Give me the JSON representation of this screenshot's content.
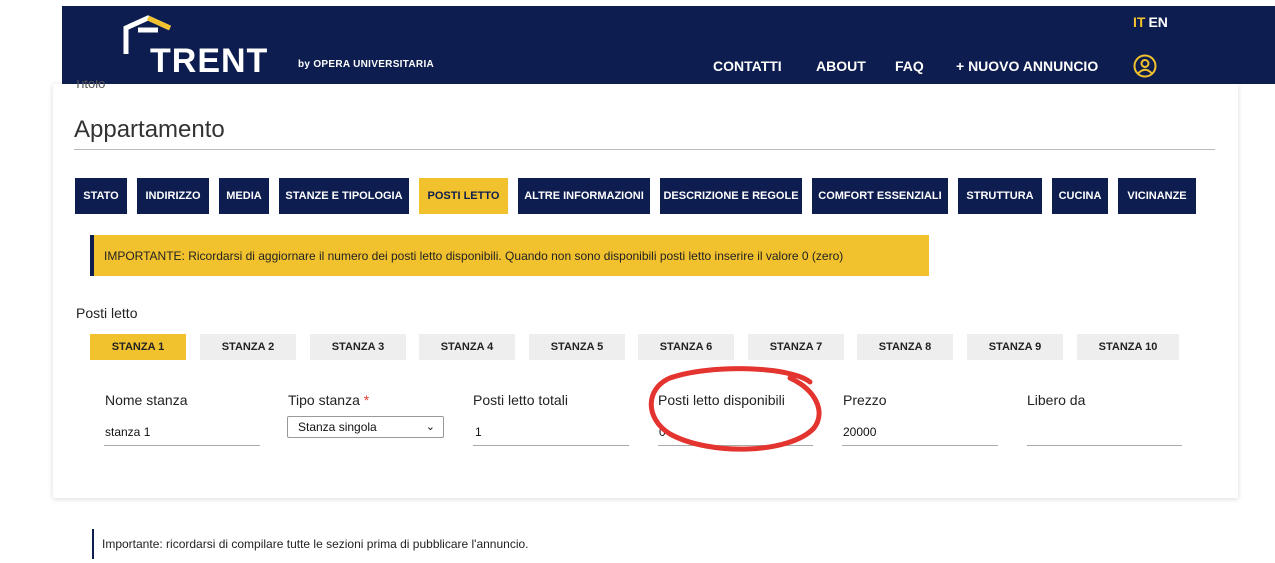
{
  "header": {
    "logo_text": "TRENT",
    "logo_by": "by OPERA UNIVERSITARIA",
    "nav": [
      "CONTATTI",
      "ABOUT",
      "FAQ",
      "+ NUOVO ANNUNCIO"
    ],
    "lang_it": "IT",
    "lang_en": "EN",
    "colors": {
      "navy": "#0d1d4f",
      "accent": "#f2c12e"
    }
  },
  "form": {
    "titolo_label": "Titolo",
    "title": "Appartamento",
    "tabs": [
      "STATO",
      "INDIRIZZO",
      "MEDIA",
      "STANZE E TIPOLOGIA",
      "POSTI LETTO",
      "ALTRE INFORMAZIONI",
      "DESCRIZIONE E REGOLE",
      "COMFORT ESSENZIALI",
      "STRUTTURA",
      "CUCINA",
      "VICINANZE"
    ],
    "active_tab": "POSTI LETTO",
    "alert": "IMPORTANTE: Ricordarsi di aggiornare il numero dei posti letto disponibili. Quando non sono disponibili posti letto inserire il valore 0 (zero)",
    "section_label": "Posti letto",
    "room_tabs": [
      "STANZA 1",
      "STANZA 2",
      "STANZA 3",
      "STANZA 4",
      "STANZA 5",
      "STANZA 6",
      "STANZA 7",
      "STANZA 8",
      "STANZA 9",
      "STANZA 10"
    ],
    "active_room": "STANZA 1",
    "fields": {
      "nome_label": "Nome stanza",
      "nome_value": "stanza 1",
      "tipo_label": "Tipo stanza",
      "tipo_required": "*",
      "tipo_value": "Stanza singola",
      "totali_label": "Posti letto totali",
      "totali_value": "1",
      "disponibili_label": "Posti letto disponibili",
      "disponibili_value": "0",
      "prezzo_label": "Prezzo",
      "prezzo_value": "20000",
      "libero_label": "Libero da",
      "libero_value": ""
    }
  },
  "footer_note": "Importante: ricordarsi di compilare tutte le sezioni prima di pubblicare l'annuncio.",
  "annotation": {
    "highlight_color": "#e3342f"
  }
}
